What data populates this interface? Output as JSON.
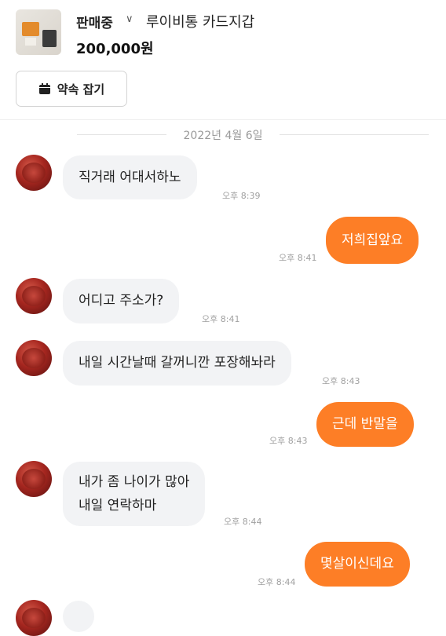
{
  "header": {
    "status": "판매중",
    "item_title": "루이비통 카드지갑",
    "price": "200,000원",
    "appointment_button": "약속 잡기"
  },
  "date_divider": "2022년 4월 6일",
  "messages": [
    {
      "side": "in",
      "text": "직거래 어대서하노",
      "time": "오후 8:39"
    },
    {
      "side": "out",
      "text": "저희집앞요",
      "time": "오후 8:41"
    },
    {
      "side": "in",
      "text": "어디고 주소가?",
      "time": "오후 8:41"
    },
    {
      "side": "in",
      "text": "내일 시간날때 갈꺼니깐 포장해놔라",
      "time": "오후 8:43"
    },
    {
      "side": "out",
      "text": "근데 반말을",
      "time": "오후 8:43"
    },
    {
      "side": "in",
      "lines": [
        "내가 좀 나이가 많아",
        "내일 연락하마"
      ],
      "time": "오후 8:44"
    },
    {
      "side": "out",
      "text": "몇살이신데요",
      "time": "오후 8:44"
    }
  ],
  "colors": {
    "accent": "#fd7e26",
    "incoming_bubble": "#f2f3f5"
  }
}
